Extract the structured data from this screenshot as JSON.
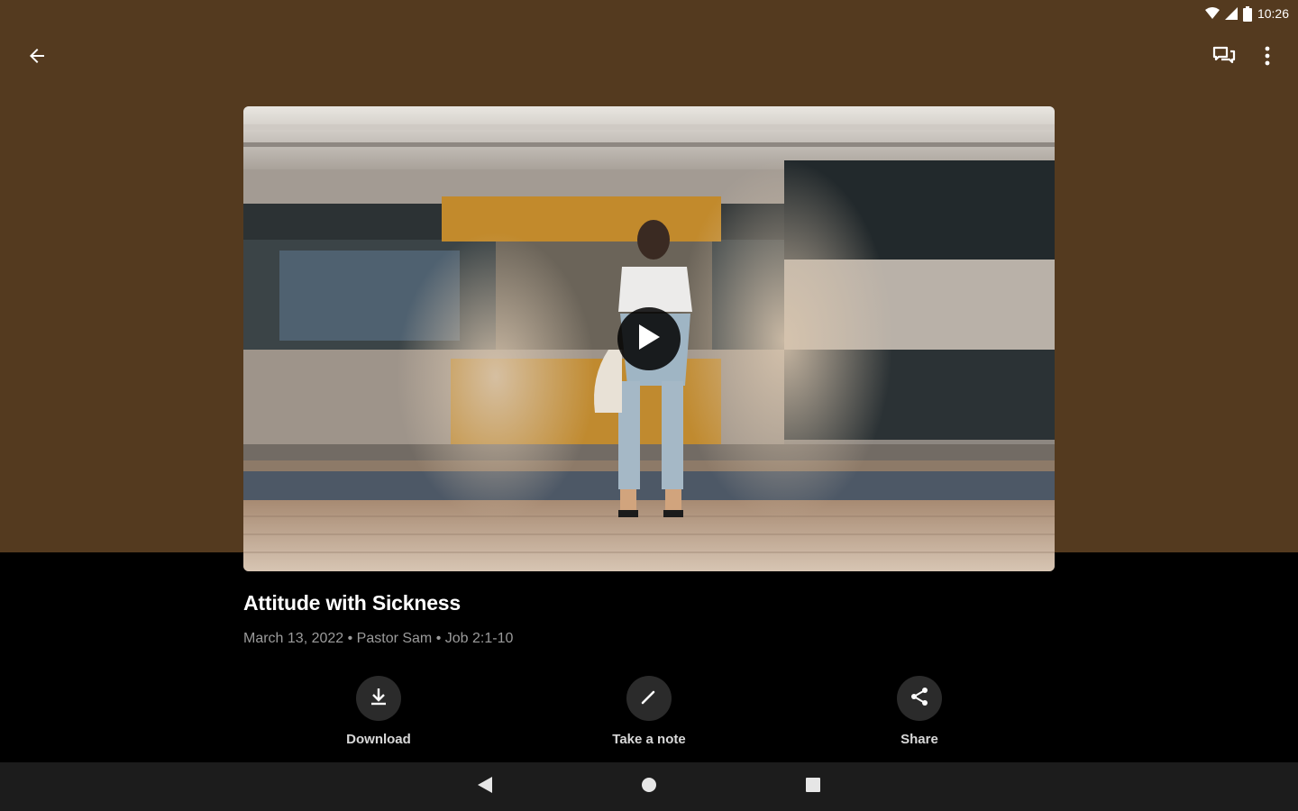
{
  "status_bar": {
    "time": "10:26"
  },
  "toolbar": {
    "back_icon": "arrow-left-icon",
    "chat_icon": "chat-bubbles-icon",
    "more_icon": "more-vertical-icon"
  },
  "colors": {
    "hero_background": "#543a1f",
    "body_background": "#000000",
    "navbar": "#1c1c1c"
  },
  "video": {
    "play_icon": "play-icon"
  },
  "sermon": {
    "title": "Attitude with Sickness",
    "meta": "March 13, 2022 • Pastor Sam • Job 2:1-10"
  },
  "actions": [
    {
      "label": "Download",
      "icon": "download-icon"
    },
    {
      "label": "Take a note",
      "icon": "pencil-icon"
    },
    {
      "label": "Share",
      "icon": "share-icon"
    }
  ],
  "nav_bar": {
    "back": "triangle-back-icon",
    "home": "circle-home-icon",
    "recents": "square-recents-icon"
  }
}
